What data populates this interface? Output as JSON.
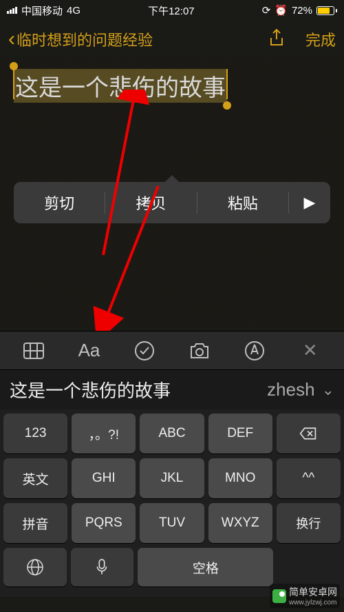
{
  "status": {
    "carrier": "中国移动",
    "network": "4G",
    "time": "下午12:07",
    "battery_pct": "72%",
    "battery_fill": 72
  },
  "nav": {
    "back_label": "临时想到的问题经验",
    "done": "完成"
  },
  "note": {
    "text": "这是一个悲伤的故事"
  },
  "context_menu": {
    "cut": "剪切",
    "copy": "拷贝",
    "paste": "粘贴",
    "more": "▶"
  },
  "format_bar": {
    "text_style": "Aa"
  },
  "candidates": {
    "primary": "这是一个悲伤的故事",
    "secondary": "zhesh"
  },
  "keyboard": {
    "r1": [
      "123",
      "，。?!",
      "ABC",
      "DEF"
    ],
    "r2": [
      "英文",
      "GHI",
      "JKL",
      "MNO"
    ],
    "r3": [
      "拼音",
      "PQRS",
      "TUV",
      "WXYZ"
    ],
    "r4_globe": "",
    "r4_mic": "",
    "r4_space": "空格",
    "r4_return": "换行",
    "shift": "^^"
  },
  "watermark": {
    "name": "简单安卓网",
    "url": "www.jylzwj.com"
  }
}
